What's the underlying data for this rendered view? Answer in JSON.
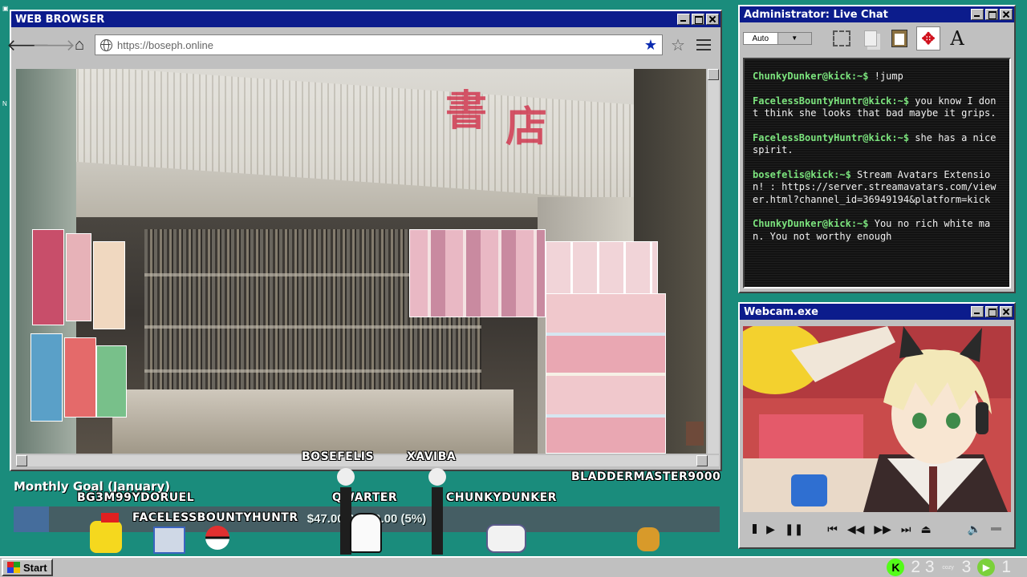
{
  "browser": {
    "title": "WEB BROWSER",
    "url": "https://boseph.online",
    "icons": [
      "back-arrow-icon",
      "forward-arrow-icon",
      "home-icon",
      "globe-icon",
      "bookmark-star-icon",
      "star-outline-icon",
      "menu-icon"
    ],
    "sign_chars": [
      "書",
      "店"
    ]
  },
  "chat": {
    "title": "Administrator: Live Chat",
    "font_select": "Auto",
    "messages": [
      {
        "user": "ChunkyDunker@kick:~$",
        "text": " !jump"
      },
      {
        "user": "FacelessBountyHuntr@kick:~$",
        "text": " you know I dont think she looks that bad maybe it grips."
      },
      {
        "user": "FacelessBountyHuntr@kick:~$",
        "text": " she has a nice spirit."
      },
      {
        "user": "bosefelis@kick:~$",
        "text": " Stream Avatars Extension! : https://server.streamavatars.com/viewer.html?channel_id=36949194&platform=kick"
      },
      {
        "user": "ChunkyDunker@kick:~$",
        "text": " You no rich white man. You not worthy enough"
      }
    ]
  },
  "webcam": {
    "title": "Webcam.exe"
  },
  "goal": {
    "title": "Monthly Goal (January)",
    "amount": "$47.00/$1000.00 (5%)",
    "progress": 0.05
  },
  "avatars": {
    "names": [
      "BOSEFELIS",
      "XAVIBA",
      "BG3M99YDORUEL",
      "QWARTER",
      "CHUNKYDUNKER",
      "BLADDERMASTER9000",
      "FACELESSBOUNTYHUNTR"
    ]
  },
  "taskbar": {
    "start": "Start",
    "tray_digits_a": "2 3",
    "cozy_label": "cozy",
    "tray_digit_b": "3",
    "tray_digit_c": "1"
  },
  "colors": {
    "desktop": "#1a8c7c",
    "titlebar": "#0c1c8c",
    "chat_user": "#79e37b",
    "kick_green": "#53fc18"
  }
}
